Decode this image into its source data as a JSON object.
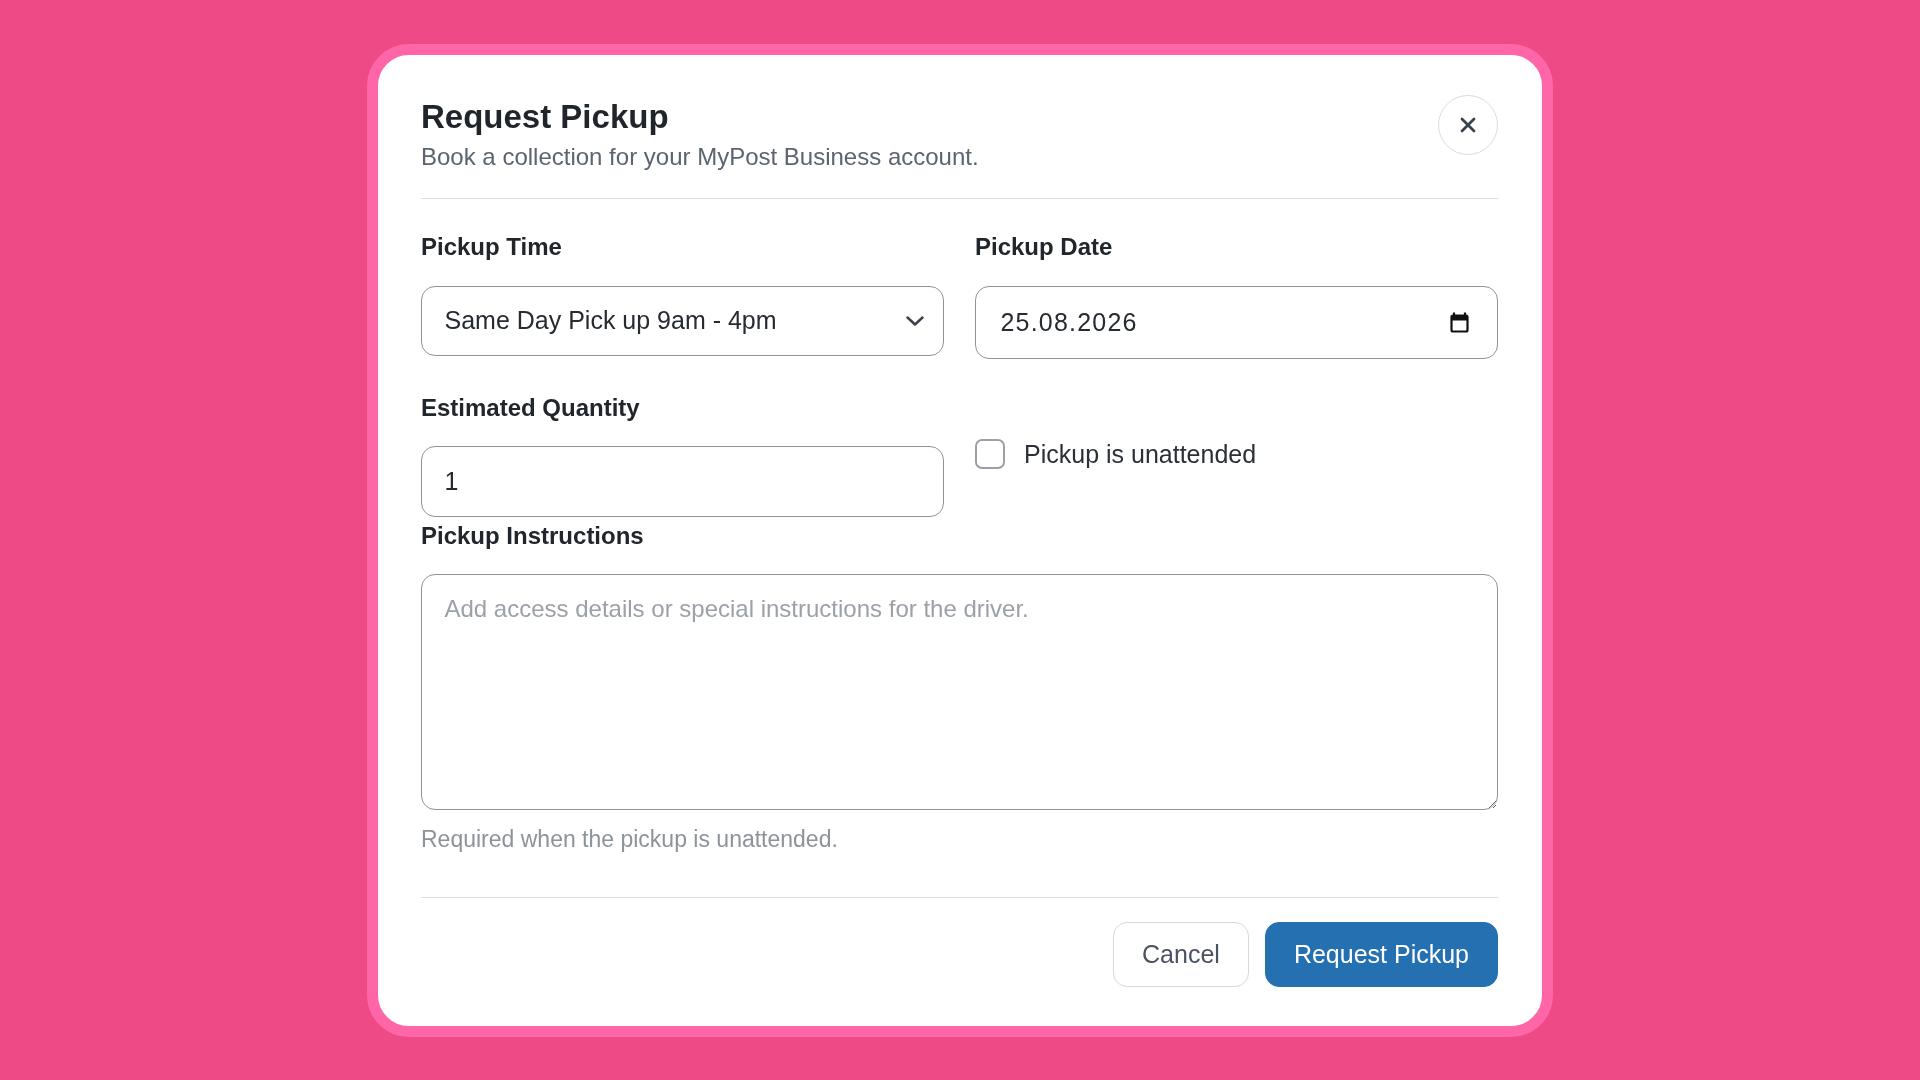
{
  "dialog": {
    "title": "Request Pickup",
    "subtitle": "Book a collection for your MyPost Business account."
  },
  "fields": [
    {
      "kind": "select",
      "label": "Pickup Time",
      "value": "Same Day Pick up 9am - 4pm"
    },
    {
      "kind": "date",
      "label": "Pickup Date",
      "value": "25.08.2026"
    },
    {
      "kind": "number",
      "label": "Estimated Quantity",
      "value": "1"
    },
    {
      "kind": "checkbox",
      "label": "Pickup is unattended",
      "checked": false
    },
    {
      "kind": "textarea",
      "label": "Pickup Instructions",
      "placeholder": "Add access details or special instructions for the driver.",
      "help": "Required when the pickup is unattended."
    }
  ],
  "buttons": [
    {
      "kind": "secondary",
      "label": "Cancel"
    },
    {
      "kind": "primary",
      "label": "Request Pickup"
    }
  ]
}
